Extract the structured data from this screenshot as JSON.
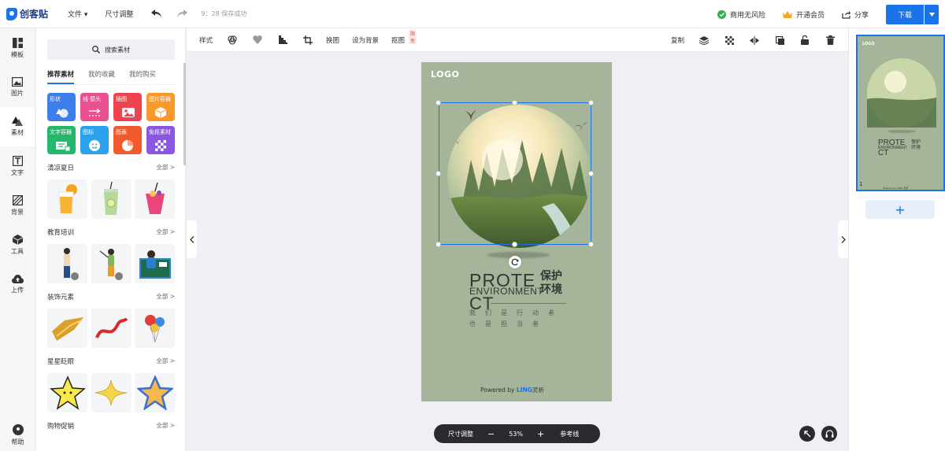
{
  "app": {
    "brand": "创客贴",
    "menu": {
      "file": "文件 ▾",
      "resize": "尺寸调整"
    },
    "save_status": "9：28 保存成功"
  },
  "top_right": {
    "commercial": "商用无风险",
    "vip": "开通会员",
    "share": "分享",
    "download": "下载"
  },
  "rail": {
    "items": [
      {
        "label": "模板",
        "icon": "template-icon"
      },
      {
        "label": "图片",
        "icon": "image-icon"
      },
      {
        "label": "素材",
        "icon": "material-icon"
      },
      {
        "label": "文字",
        "icon": "text-icon"
      },
      {
        "label": "背景",
        "icon": "background-icon"
      },
      {
        "label": "工具",
        "icon": "tools-icon"
      },
      {
        "label": "上传",
        "icon": "upload-icon"
      }
    ],
    "help": "帮助"
  },
  "panel": {
    "search_label": "搜索素材",
    "tabs": [
      "推荐素材",
      "我的收藏",
      "我的购买"
    ],
    "categories": [
      {
        "label": "形状",
        "color": "#3d7eea"
      },
      {
        "label": "线·箭头",
        "color": "#e9508f"
      },
      {
        "label": "插图",
        "color": "#ee4450"
      },
      {
        "label": "图片容器",
        "color": "#f79a2b"
      },
      {
        "label": "文字容器",
        "color": "#25b86b"
      },
      {
        "label": "图标",
        "color": "#2aa2ee"
      },
      {
        "label": "图表",
        "color": "#f25a2c"
      },
      {
        "label": "免抠素材",
        "color": "#8a57e2"
      }
    ],
    "sections": [
      {
        "title": "清凉夏日",
        "all": "全部 >"
      },
      {
        "title": "教育培训",
        "all": "全部 >"
      },
      {
        "title": "装饰元素",
        "all": "全部 >"
      },
      {
        "title": "星星眨眼",
        "all": "全部 >"
      },
      {
        "title": "购物促销",
        "all": "全部 >"
      }
    ]
  },
  "toolbar": {
    "style": "样式",
    "replace": "换图",
    "set_background": "设为背景",
    "cutout": "抠图",
    "cutout_badge": "限免",
    "copy": "复制"
  },
  "poster": {
    "logo": "LOGO",
    "title_line1": "PROTE",
    "title_line2": "ENVIRONMENT",
    "title_line3": "CT",
    "title_cn": "保护环境",
    "sub1": "我们是行动者",
    "sub2": "也是担当者",
    "powered_prefix": "Powered by",
    "powered_brand": "LING",
    "powered_suffix": "灵析"
  },
  "zoom": {
    "resize": "尺寸调整",
    "minus": "−",
    "value": "53%",
    "plus": "+",
    "guides": "参考线"
  },
  "pages": {
    "page_number": "1",
    "add": "+"
  }
}
